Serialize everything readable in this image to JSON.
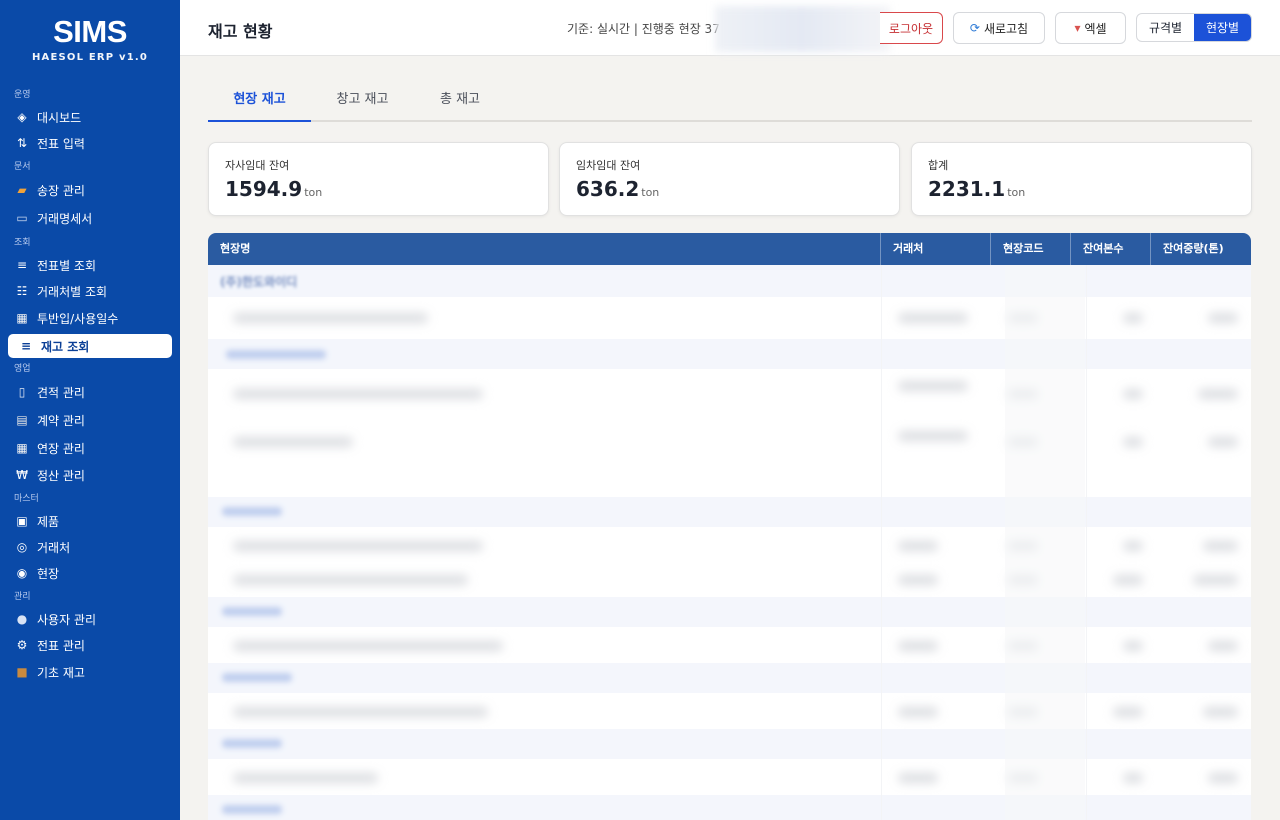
{
  "sidebar": {
    "brand": "SIMS",
    "version": "HAESOL ERP v1.0",
    "sections": {
      "ops": "운영",
      "docs": "문서",
      "query": "조회",
      "sales": "영업",
      "master": "마스터",
      "admin": "관리"
    },
    "items": {
      "dashboard": "대시보드",
      "slip_entry": "전표 입력",
      "invoice": "송장 관리",
      "statement": "거래명세서",
      "by_slip": "전표별 조회",
      "by_client": "거래처별 조회",
      "input_days": "투반입/사용일수",
      "stock": "재고 조회",
      "quote": "견적 관리",
      "contract": "계약 관리",
      "extension": "연장 관리",
      "settlement": "정산 관리",
      "product": "제품",
      "client": "거래처",
      "site": "현장",
      "users": "사용자 관리",
      "slip_admin": "전표 관리",
      "base_stock": "기초 재고"
    }
  },
  "header": {
    "title": "재고 현황",
    "status": "기준: 실시간 | 진행중 현장 37",
    "logout": "로그아웃",
    "refresh": "새로고침",
    "excel": "엑셀",
    "toggle": [
      "규격별",
      "현장별"
    ]
  },
  "tabs": [
    "현장 재고",
    "창고 재고",
    "총 재고"
  ],
  "cards": [
    {
      "label": "자사임대 잔여",
      "value": "1594.9",
      "unit": "ton"
    },
    {
      "label": "임차임대 잔여",
      "value": "636.2",
      "unit": "ton"
    },
    {
      "label": "합계",
      "value": "2231.1",
      "unit": "ton"
    }
  ],
  "table": {
    "columns": [
      "현장명",
      "거래처",
      "현장코드",
      "잔여본수",
      "잔여중량(톤)"
    ],
    "first_group": "(주)한도와이디"
  },
  "colors": {
    "sidebar": "#0a4aa8",
    "accent": "#1c52d8",
    "table_header": "#2a5ba1",
    "logout": "#c62f33"
  }
}
